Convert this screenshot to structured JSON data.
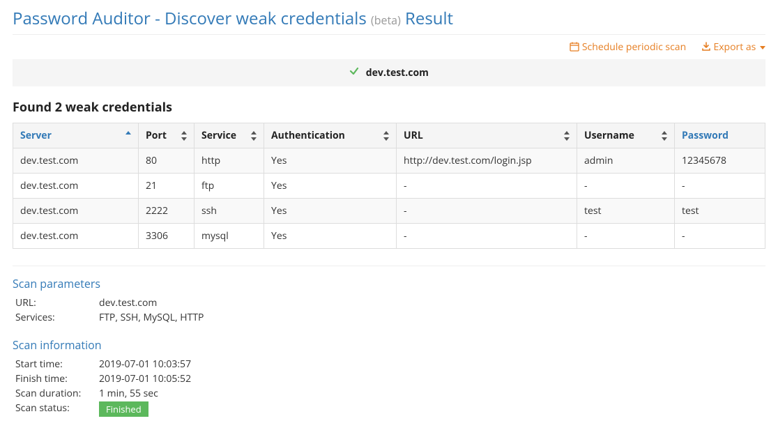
{
  "header": {
    "tool_name": "Password Auditor - Discover weak credentials",
    "beta_tag": "(beta)",
    "result_word": "Result"
  },
  "actions": {
    "schedule_label": "Schedule periodic scan",
    "export_label": "Export as"
  },
  "target": {
    "hostname": "dev.test.com"
  },
  "found_heading": "Found 2 weak credentials",
  "table": {
    "columns": {
      "server": "Server",
      "port": "Port",
      "service": "Service",
      "auth": "Authentication",
      "url": "URL",
      "username": "Username",
      "password": "Password"
    },
    "rows": [
      {
        "server": "dev.test.com",
        "port": "80",
        "service": "http",
        "auth": "Yes",
        "url": "http://dev.test.com/login.jsp",
        "username": "admin",
        "password": "12345678"
      },
      {
        "server": "dev.test.com",
        "port": "21",
        "service": "ftp",
        "auth": "Yes",
        "url": "-",
        "username": "-",
        "password": "-"
      },
      {
        "server": "dev.test.com",
        "port": "2222",
        "service": "ssh",
        "auth": "Yes",
        "url": "-",
        "username": "test",
        "password": "test"
      },
      {
        "server": "dev.test.com",
        "port": "3306",
        "service": "mysql",
        "auth": "Yes",
        "url": "-",
        "username": "-",
        "password": "-"
      }
    ]
  },
  "scan_params": {
    "heading": "Scan parameters",
    "url_label": "URL:",
    "url_value": "dev.test.com",
    "services_label": "Services:",
    "services_value": "FTP, SSH, MySQL, HTTP"
  },
  "scan_info": {
    "heading": "Scan information",
    "start_label": "Start time:",
    "start_value": "2019-07-01 10:03:57",
    "finish_label": "Finish time:",
    "finish_value": "2019-07-01 10:05:52",
    "duration_label": "Scan duration:",
    "duration_value": "1 min, 55 sec",
    "status_label": "Scan status:",
    "status_value": "Finished"
  }
}
